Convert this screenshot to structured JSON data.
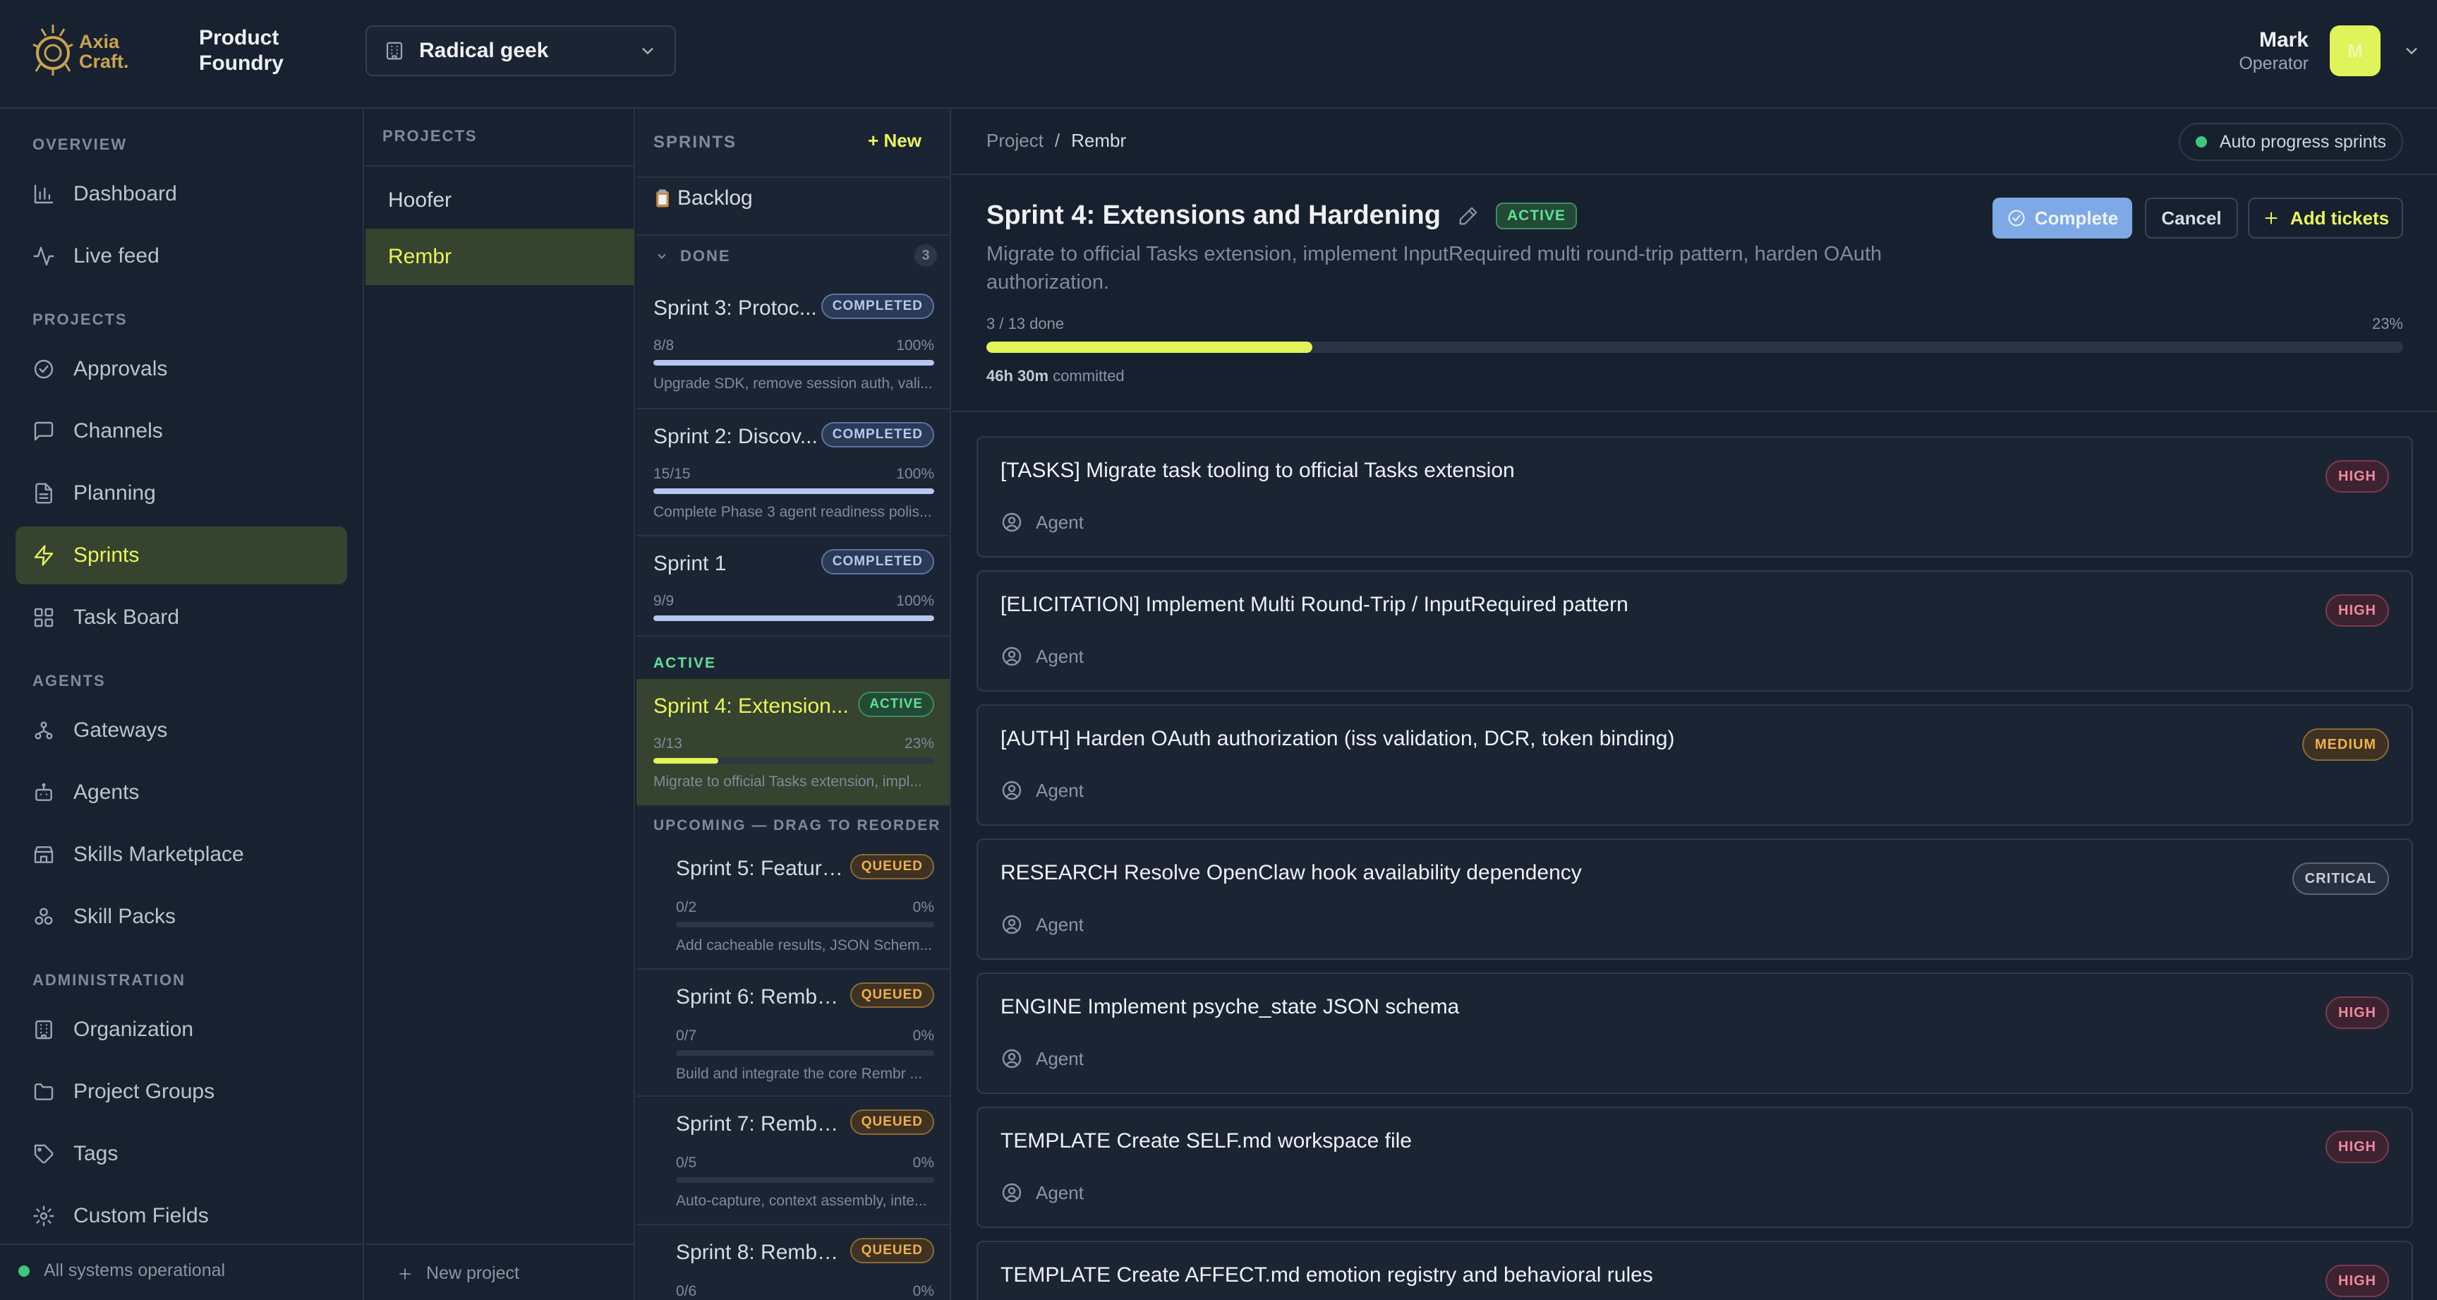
{
  "app": {
    "logo_text_line1": "Axia",
    "logo_text_line2": "Craft.",
    "org_name": "Product Foundry",
    "project_selector": "Radical geek",
    "user_name": "Mark",
    "user_role": "Operator",
    "user_initial": "M",
    "accent_color": "#e8f55a"
  },
  "sidebar": {
    "sections": [
      {
        "label": "OVERVIEW",
        "items": [
          {
            "label": "Dashboard",
            "icon": "bar-chart-icon"
          },
          {
            "label": "Live feed",
            "icon": "activity-icon"
          }
        ]
      },
      {
        "label": "PROJECTS",
        "items": [
          {
            "label": "Approvals",
            "icon": "check-circle-icon"
          },
          {
            "label": "Channels",
            "icon": "message-square-icon"
          },
          {
            "label": "Planning",
            "icon": "file-text-icon"
          },
          {
            "label": "Sprints",
            "icon": "zap-icon",
            "active": true
          },
          {
            "label": "Task Board",
            "icon": "grid-icon"
          }
        ]
      },
      {
        "label": "AGENTS",
        "items": [
          {
            "label": "Gateways",
            "icon": "network-icon"
          },
          {
            "label": "Agents",
            "icon": "bot-icon"
          },
          {
            "label": "Skills Marketplace",
            "icon": "store-icon"
          },
          {
            "label": "Skill Packs",
            "icon": "boxes-icon"
          }
        ]
      },
      {
        "label": "ADMINISTRATION",
        "items": [
          {
            "label": "Organization",
            "icon": "building-icon"
          },
          {
            "label": "Project Groups",
            "icon": "folder-icon"
          },
          {
            "label": "Tags",
            "icon": "tag-icon"
          },
          {
            "label": "Custom Fields",
            "icon": "settings-icon"
          }
        ]
      }
    ],
    "status": "All systems operational"
  },
  "projects": {
    "header": "PROJECTS",
    "items": [
      "Hoofer",
      "Rembr"
    ],
    "active": "Rembr",
    "new_label": "New project"
  },
  "sprints": {
    "header": "SPRINTS",
    "new_label": "+ New",
    "backlog": "Backlog",
    "done_header": "DONE",
    "done_count": "3",
    "done": [
      {
        "title": "Sprint 3: Protoc...",
        "badge": "COMPLETED",
        "count": "8/8",
        "pct": "100%",
        "fill": 1.0,
        "desc": "Upgrade SDK, remove session auth, vali..."
      },
      {
        "title": "Sprint 2: Discov...",
        "badge": "COMPLETED",
        "count": "15/15",
        "pct": "100%",
        "fill": 1.0,
        "desc": "Complete Phase 3 agent readiness polis..."
      },
      {
        "title": "Sprint 1",
        "badge": "COMPLETED",
        "count": "9/9",
        "pct": "100%",
        "fill": 1.0,
        "desc": ""
      }
    ],
    "active_header": "ACTIVE",
    "active": {
      "title": "Sprint 4: Extension...",
      "badge": "ACTIVE",
      "count": "3/13",
      "pct": "23%",
      "fill": 0.23,
      "desc": "Migrate to official Tasks extension, impl..."
    },
    "upcoming_header": "UPCOMING — DRAG TO REORDER",
    "upcoming": [
      {
        "title": "Sprint 5: Feature...",
        "badge": "QUEUED",
        "count": "0/2",
        "pct": "0%",
        "fill": 0,
        "desc": "Add cacheable results, JSON Schem..."
      },
      {
        "title": "Sprint 6: Rembr ...",
        "badge": "QUEUED",
        "count": "0/7",
        "pct": "0%",
        "fill": 0,
        "desc": "Build and integrate the core Rembr ..."
      },
      {
        "title": "Sprint 7: Rembr ...",
        "badge": "QUEUED",
        "count": "0/5",
        "pct": "0%",
        "fill": 0,
        "desc": "Auto-capture, context assembly, inte..."
      },
      {
        "title": "Sprint 8: Rembr ...",
        "badge": "QUEUED",
        "count": "0/6",
        "pct": "0%",
        "fill": 0,
        "desc": ""
      }
    ]
  },
  "main": {
    "breadcrumb_root": "Project",
    "breadcrumb_sep": "/",
    "breadcrumb_current": "Rembr",
    "auto_progress": "Auto progress sprints",
    "title": "Sprint 4: Extensions and Hardening",
    "status": "ACTIVE",
    "description": "Migrate to official Tasks extension, implement InputRequired multi round-trip pattern, harden OAuth authorization.",
    "complete_label": "Complete",
    "cancel_label": "Cancel",
    "add_tickets_label": "Add tickets",
    "progress_label": "3 / 13 done",
    "progress_pct": "23%",
    "progress_fraction": 0.23,
    "committed_value": "46h 30m",
    "committed_label": "committed",
    "tickets": [
      {
        "title": "[TASKS] Migrate task tooling to official Tasks extension",
        "assignee": "Agent",
        "priority": "HIGH"
      },
      {
        "title": "[ELICITATION] Implement Multi Round-Trip / InputRequired pattern",
        "assignee": "Agent",
        "priority": "HIGH"
      },
      {
        "title": "[AUTH] Harden OAuth authorization (iss validation, DCR, token binding)",
        "assignee": "Agent",
        "priority": "MEDIUM"
      },
      {
        "title": "RESEARCH Resolve OpenClaw hook availability dependency",
        "assignee": "Agent",
        "priority": "CRITICAL"
      },
      {
        "title": "ENGINE Implement psyche_state JSON schema",
        "assignee": "Agent",
        "priority": "HIGH"
      },
      {
        "title": "TEMPLATE Create SELF.md workspace file",
        "assignee": "Agent",
        "priority": "HIGH"
      },
      {
        "title": "TEMPLATE Create AFFECT.md emotion registry and behavioral rules",
        "assignee": "Agent",
        "priority": "HIGH"
      }
    ]
  }
}
